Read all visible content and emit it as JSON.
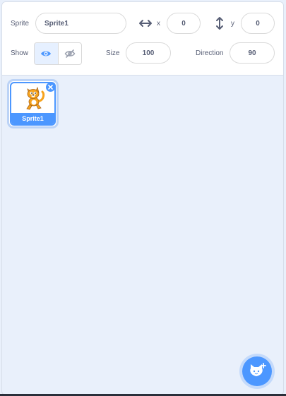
{
  "sprite_info": {
    "sprite_label": "Sprite",
    "sprite_name": "Sprite1",
    "x_label": "x",
    "x_value": "0",
    "y_label": "y",
    "y_value": "0",
    "show_label": "Show",
    "visible": true,
    "size_label": "Size",
    "size_value": "100",
    "direction_label": "Direction",
    "direction_value": "90"
  },
  "sprites": [
    {
      "name": "Sprite1",
      "selected": true,
      "icon": "cat-costume"
    }
  ],
  "add_sprite": {
    "icon": "cat-plus-icon"
  },
  "colors": {
    "accent": "#4c97ff",
    "pane_background": "#e9f0fb",
    "text": "#575e75"
  }
}
